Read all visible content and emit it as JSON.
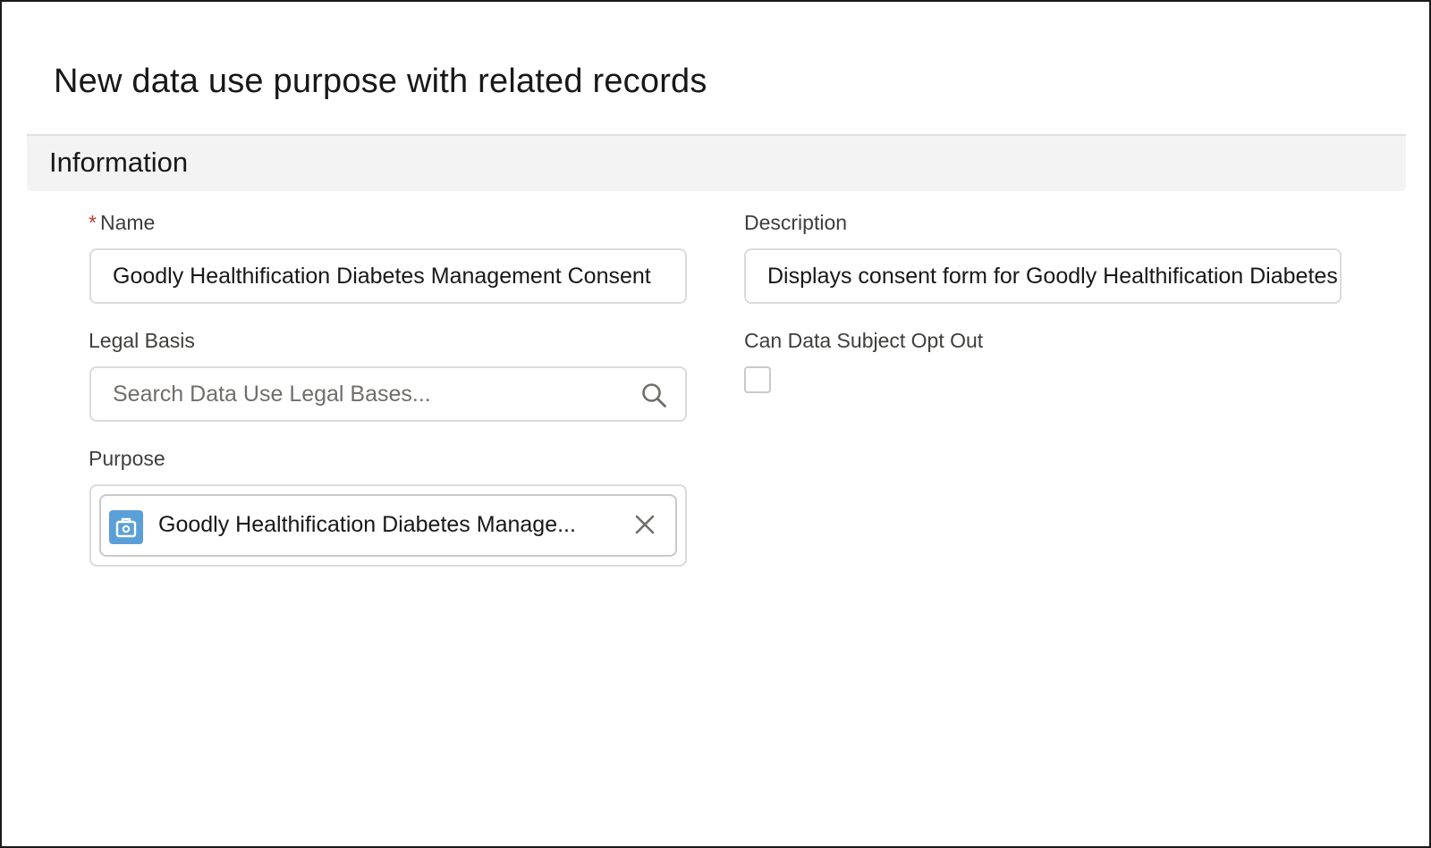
{
  "page": {
    "title": "New data use purpose with related records"
  },
  "section": {
    "title": "Information"
  },
  "fields": {
    "name": {
      "required_mark": "*",
      "label": "Name",
      "value": "Goodly Healthification Diabetes Management Consent"
    },
    "description": {
      "label": "Description",
      "value": "Displays consent form for Goodly Healthification Diabetes Management"
    },
    "legal_basis": {
      "label": "Legal Basis",
      "placeholder": "Search Data Use Legal Bases...",
      "icon": "search-icon"
    },
    "can_opt_out": {
      "label": "Can Data Subject Opt Out",
      "checked": false
    },
    "purpose": {
      "label": "Purpose",
      "selected": "Goodly Healthification Diabetes Manage...",
      "icon": "medical-kit-icon",
      "remove_icon": "close-icon",
      "icon_color": "#5a9fd8"
    }
  }
}
